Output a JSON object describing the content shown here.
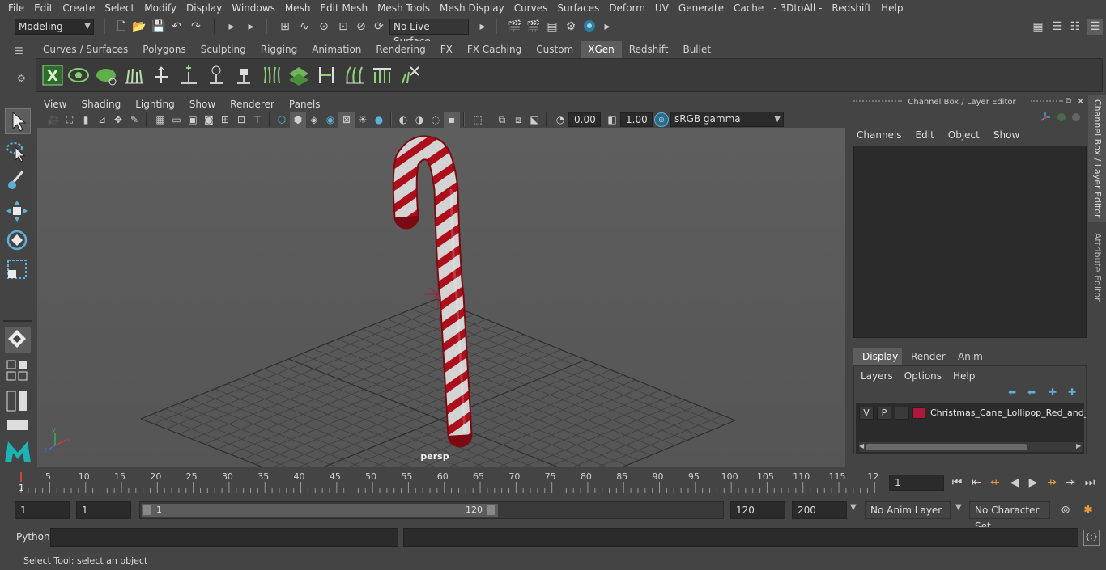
{
  "menubar": {
    "items": [
      "File",
      "Edit",
      "Create",
      "Select",
      "Modify",
      "Display",
      "Windows",
      "Mesh",
      "Edit Mesh",
      "Mesh Tools",
      "Mesh Display",
      "Curves",
      "Surfaces",
      "Deform",
      "UV",
      "Generate",
      "Cache",
      "- 3DtoAll -",
      "Redshift",
      "Help"
    ]
  },
  "statusline": {
    "mode": "Modeling",
    "live_surface": "No Live Surface"
  },
  "shelf": {
    "tabs": [
      "Curves / Surfaces",
      "Polygons",
      "Sculpting",
      "Rigging",
      "Animation",
      "Rendering",
      "FX",
      "FX Caching",
      "Custom",
      "XGen",
      "Redshift",
      "Bullet"
    ],
    "active_tab": "XGen"
  },
  "viewport": {
    "menus": [
      "View",
      "Shading",
      "Lighting",
      "Show",
      "Renderer",
      "Panels"
    ],
    "exposure": "0.00",
    "gamma": "1.00",
    "color_space": "sRGB gamma",
    "camera_label": "persp"
  },
  "channelbox": {
    "title": "Channel Box / Layer Editor",
    "menus": [
      "Channels",
      "Edit",
      "Object",
      "Show"
    ]
  },
  "layer_editor": {
    "tabs": [
      "Display",
      "Render",
      "Anim"
    ],
    "active_tab": "Display",
    "menus": [
      "Layers",
      "Options",
      "Help"
    ],
    "layers": [
      {
        "v": "V",
        "p": "P",
        "name": "Christmas_Cane_Lollipop_Red_and_G",
        "color": "#b0173a"
      }
    ]
  },
  "side_tabs": [
    "Channel Box / Layer Editor",
    "Attribute Editor"
  ],
  "timeline": {
    "ticks": [
      "5",
      "10",
      "15",
      "20",
      "25",
      "30",
      "35",
      "40",
      "45",
      "50",
      "55",
      "60",
      "65",
      "70",
      "75",
      "80",
      "85",
      "90",
      "95",
      "100",
      "105",
      "110",
      "115",
      "12"
    ],
    "first_tick": "1",
    "current_frame": "1"
  },
  "range": {
    "start": "1",
    "playback_start": "1",
    "slider_start": "1",
    "slider_end": "120",
    "playback_end": "120",
    "end": "200",
    "anim_layer": "No Anim Layer",
    "character_set": "No Character Set"
  },
  "cmdline": {
    "label": "Python"
  },
  "helpline": {
    "text": "Select Tool: select an object"
  },
  "colors": {
    "accent": "#5285a6",
    "timeline_red": "#d0463c"
  }
}
